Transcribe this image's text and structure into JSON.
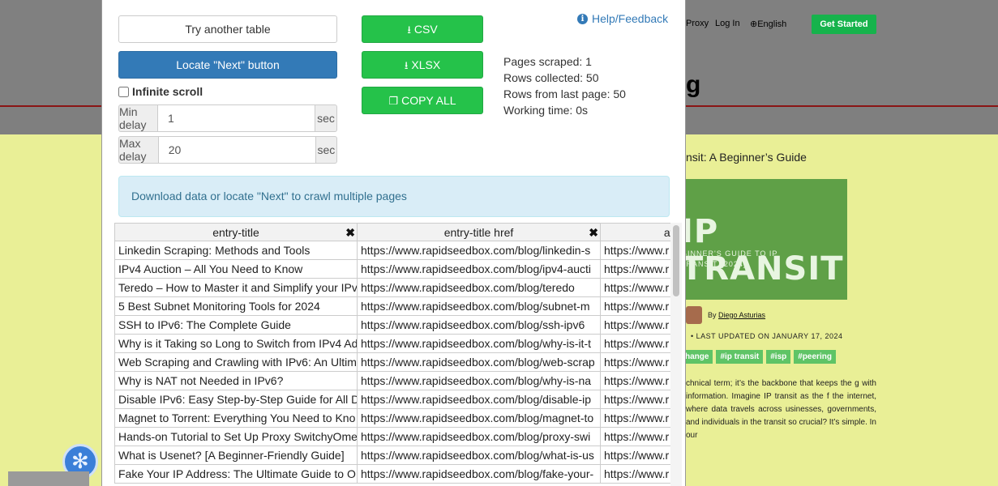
{
  "background": {
    "nav": [
      "Proxy",
      "Log In",
      "English"
    ],
    "get_started": "Get Started",
    "heading_fragment": "g",
    "article_title": "nsit: A Beginner’s Guide",
    "hero_big": "IP TRANSIT",
    "hero_sub_line1": "GINNER'S GUIDE TO IP",
    "hero_sub_line2": "TRANSIT (2024)",
    "author_prefix": "By",
    "author_name": "Diego Asturias",
    "last_updated": "• LAST UPDATED ON JANUARY 17, 2024",
    "tags": [
      "hange",
      "#ip transit",
      "#isp",
      "#peering"
    ],
    "paragraph": "chnical term; it’s the backbone that keeps the g with information. Imagine IP transit as the f the internet, where data travels across usinesses, governments, and individuals in the transit so crucial? It’s simple. In our"
  },
  "popup": {
    "try_another": "Try another table",
    "locate_next": "Locate \"Next\" button",
    "csv": "CSV",
    "xlsx": "XLSX",
    "copy_all": "COPY ALL",
    "help": "Help/Feedback",
    "infinite_scroll": "Infinite scroll",
    "min_delay_label": "Min delay",
    "min_delay_value": "1",
    "max_delay_label": "Max delay",
    "max_delay_value": "20",
    "sec": "sec",
    "stats": {
      "pages": "Pages scraped: 1",
      "rows": "Rows collected: 50",
      "last_page": "Rows from last page: 50",
      "time": "Working time: 0s"
    },
    "info": "Download data or locate \"Next\" to crawl multiple pages",
    "columns": [
      "entry-title",
      "entry-title href",
      "attach"
    ],
    "rows": [
      [
        "Linkedin Scraping: Methods and Tools",
        "https://www.rapidseedbox.com/blog/linkedin-s",
        "https://www.r"
      ],
      [
        "IPv4 Auction – All You Need to Know",
        "https://www.rapidseedbox.com/blog/ipv4-aucti",
        "https://www.r"
      ],
      [
        "Teredo – How to Master it and Simplify your IPv",
        "https://www.rapidseedbox.com/blog/teredo",
        "https://www.r"
      ],
      [
        "5 Best Subnet Monitoring Tools for 2024",
        "https://www.rapidseedbox.com/blog/subnet-m",
        "https://www.r"
      ],
      [
        "SSH to IPv6: The Complete Guide",
        "https://www.rapidseedbox.com/blog/ssh-ipv6",
        "https://www.r"
      ],
      [
        "Why is it Taking so Long to Switch from IPv4 Ad",
        "https://www.rapidseedbox.com/blog/why-is-it-t",
        "https://www.r"
      ],
      [
        "Web Scraping and Crawling with IPv6: An Ultim",
        "https://www.rapidseedbox.com/blog/web-scrap",
        "https://www.r"
      ],
      [
        "Why is NAT not Needed in IPv6?",
        "https://www.rapidseedbox.com/blog/why-is-na",
        "https://www.r"
      ],
      [
        "Disable IPv6: Easy Step-by-Step Guide for All D",
        "https://www.rapidseedbox.com/blog/disable-ip",
        "https://www.r"
      ],
      [
        "Magnet to Torrent: Everything You Need to Kno",
        "https://www.rapidseedbox.com/blog/magnet-to",
        "https://www.r"
      ],
      [
        "Hands-on Tutorial to Set Up Proxy SwitchyOme",
        "https://www.rapidseedbox.com/blog/proxy-swi",
        "https://www.r"
      ],
      [
        "What is Usenet? [A Beginner-Friendly Guide]",
        "https://www.rapidseedbox.com/blog/what-is-us",
        "https://www.r"
      ],
      [
        "Fake Your IP Address: The Ultimate Guide to O",
        "https://www.rapidseedbox.com/blog/fake-your-",
        "https://www.r"
      ]
    ]
  },
  "colors": {
    "primary": "#337ab7",
    "success": "#25c24a",
    "info_bg": "#d9edf7",
    "info_text": "#31708f"
  }
}
